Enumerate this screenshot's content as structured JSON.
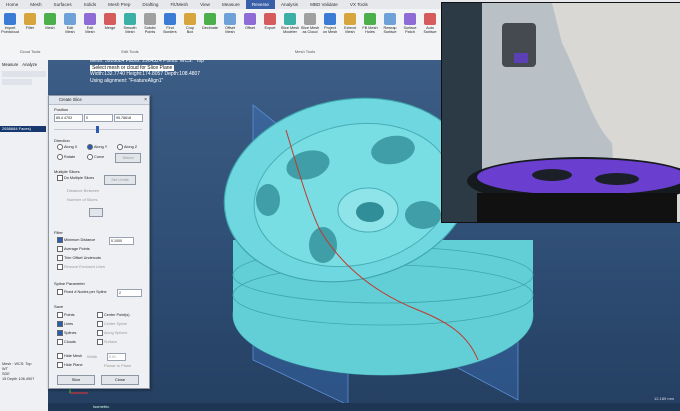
{
  "ribbon": {
    "tabs": [
      "Home",
      "Mesh",
      "Surfaces",
      "Solids",
      "Mesh Prep",
      "Drafting",
      "Fit/Mesh",
      "View",
      "Measure",
      "Reverse",
      "Analysis",
      "MBD Validate",
      "VX Tools"
    ],
    "active_tab": "Reverse",
    "tools": [
      {
        "label": "Import\nPointcloud",
        "icon": "import-icon"
      },
      {
        "label": "Filter",
        "icon": "filter-icon"
      },
      {
        "label": "Mesh",
        "icon": "mesh-icon"
      },
      {
        "label": "Edit\nMesh",
        "icon": "edit-mesh-icon"
      },
      {
        "label": "Edit\nMesh",
        "icon": "edit-mesh-icon"
      },
      {
        "label": "Merge",
        "icon": "merge-icon"
      },
      {
        "label": "Smooth\nMesh",
        "icon": "smooth-icon"
      },
      {
        "label": "Subdiv\nPoints",
        "icon": "subdiv-icon"
      },
      {
        "label": "Find\nBorders",
        "icon": "borders-icon"
      },
      {
        "label": "Crop\nBox",
        "icon": "crop-icon"
      },
      {
        "label": "Decimate",
        "icon": "decimate-icon"
      },
      {
        "label": "Offset\nMesh",
        "icon": "offset-icon"
      },
      {
        "label": "Offset",
        "icon": "offset-icon"
      },
      {
        "label": "Export",
        "icon": "export-icon"
      },
      {
        "label": "Slice Mesh\nModeler",
        "icon": "slice-icon"
      },
      {
        "label": "Slice Mesh\nas Cloud",
        "icon": "slice-cloud-icon"
      },
      {
        "label": "Project\non Mesh",
        "icon": "project-icon"
      },
      {
        "label": "Extend\nMesh",
        "icon": "extend-icon"
      },
      {
        "label": "Fill Mesh\nHoles",
        "icon": "fill-holes-icon"
      },
      {
        "label": "Rewrap\nSurface",
        "icon": "rewrap-icon"
      },
      {
        "label": "Surface\nPatch",
        "icon": "surface-patch-icon"
      },
      {
        "label": "Auto\nSurface",
        "icon": "auto-surface-icon"
      },
      {
        "label": "Multi\nSurface",
        "icon": "multi-surface-icon"
      },
      {
        "label": "Line",
        "icon": "line-icon"
      }
    ],
    "groups": [
      "Cloud Tools",
      "Edit Tools",
      "Mesh Tools",
      "Surface Tools"
    ]
  },
  "left_panel": {
    "tabs": [
      "Measure",
      "Analyze"
    ],
    "selected_item": "2658684 Faces)",
    "status": [
      "Mesh : WCS: Top",
      "WT",
      "SDE",
      "15 Depth 106.4907"
    ]
  },
  "viewport": {
    "info_line1": "Mesh: 5926684 Faces: 2964324 Points: WCS: \"Top\"",
    "info_highlight": "Select mesh or cloud for Slice Plane",
    "info_line3": "Width:132.7740 Height:174.8057 Depth:108.4807",
    "info_line4": "Using alignment: \"FeatureAlign1\"",
    "bottom_label": "Isometric",
    "scale": "12.189 mm"
  },
  "dialog": {
    "title": "Create Slice",
    "position_label": "Position",
    "position_values": [
      "85.4 4753",
      "0",
      "95.78618"
    ],
    "direction_label": "Direction",
    "direction_options": [
      "Along X",
      "Along Y",
      "Along Z"
    ],
    "direction_selected": "Along Y",
    "direction_options2": [
      "Rotate",
      "Curve"
    ],
    "direction_button": "Select",
    "multiple_label": "Multiple Slices",
    "multiple_checkbox": "Do Multiple Slices",
    "set_limits": "Set Limits",
    "distance_between": "Distance Between",
    "number_of_slices": "Number of Slices",
    "filter_label": "Filter",
    "min_distance": "Minimum Distance",
    "min_distance_value": "0.1000",
    "average_points": "Average Points",
    "trim_offset": "Trim Offset Undercuts",
    "remove_enclosed": "Remove Enclosed Lines",
    "spline_label": "Spline Parameter",
    "fixed_nodes": "Fixed # Nodes per Spline",
    "fixed_nodes_value": "2",
    "save_label": "Save",
    "save_options": [
      "Points",
      "Lines",
      "Splines",
      "Clouds"
    ],
    "save_checked": [
      "Lines",
      "Splines"
    ],
    "save_options_right": [
      "Center Point(s)",
      "Center Spline",
      "Along Splines",
      "Surface"
    ],
    "hide_mesh": "Hide Mesh",
    "width_label": "Width",
    "width_value": "0.01",
    "hide_plane": "Hide Plane",
    "plane_to_planar": "Planar to Plane",
    "slice_button": "Slice",
    "close_button": "Close"
  },
  "colors": {
    "ribbon_active": "#3a5ea8",
    "wheel": "#6fd7df",
    "slice_line": "#c0392b",
    "plane": "#3e79c9"
  }
}
